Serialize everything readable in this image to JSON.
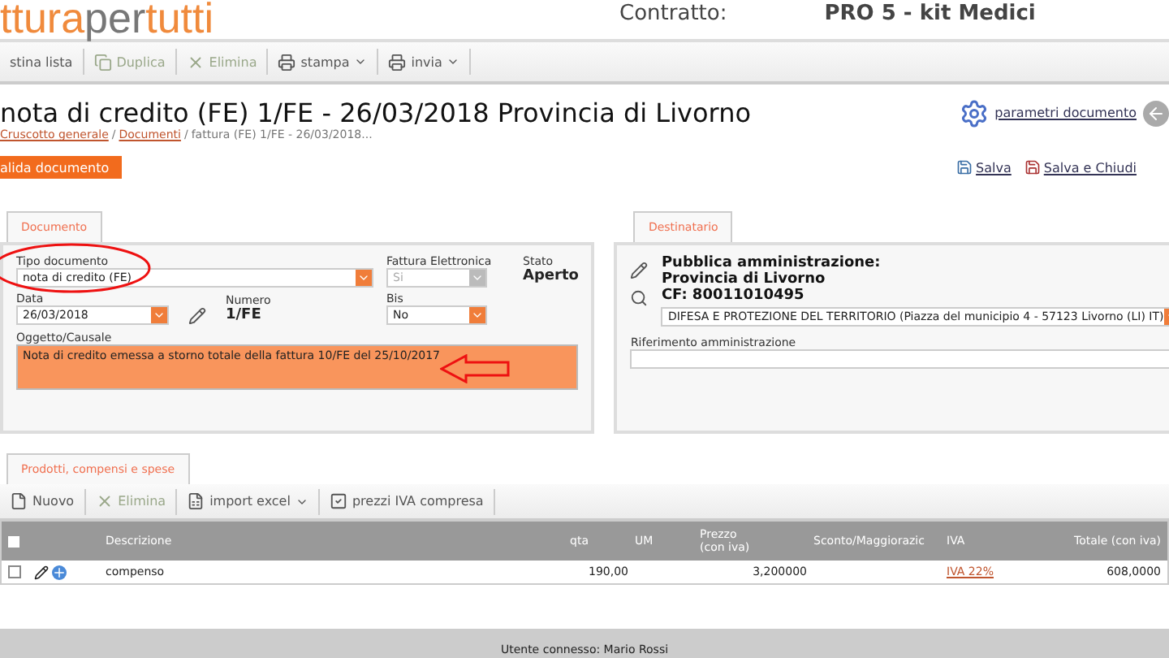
{
  "header": {
    "logo_parts": [
      "ttura",
      "per",
      "tutti"
    ],
    "contract_label": "Contratto:",
    "contract_value": "PRO 5 - kit Medici"
  },
  "toolbar": [
    {
      "label": "stina lista",
      "disabled": false,
      "caret": false
    },
    {
      "label": "Duplica",
      "disabled": true,
      "caret": false
    },
    {
      "label": "Elimina",
      "disabled": true,
      "caret": false
    },
    {
      "label": "stampa",
      "disabled": false,
      "caret": true
    },
    {
      "label": "invia",
      "disabled": false,
      "caret": true
    }
  ],
  "title": "nota di credito (FE) 1/FE - 26/03/2018 Provincia di Livorno",
  "breadcrumb": [
    {
      "label": "Cruscotto generale",
      "link": true
    },
    {
      "label": "/",
      "link": false
    },
    {
      "label": "Documenti",
      "link": true
    },
    {
      "label": "/",
      "link": false
    },
    {
      "label": "fattura (FE) 1/FE - 26/03/2018...",
      "link": false
    }
  ],
  "settings_link": "parametri documento",
  "validate_button": "alida documento",
  "actions": [
    {
      "label": "Salva"
    },
    {
      "label": "Salva e Chiudi"
    }
  ],
  "documento": {
    "tab": "Documento",
    "tipo": {
      "label": "Tipo documento",
      "value": "nota di credito (FE)"
    },
    "fattura_elettronica": {
      "label": "Fattura Elettronica",
      "value": "Si",
      "disabled": true
    },
    "stato": {
      "label": "Stato",
      "value": "Aperto"
    },
    "data": {
      "label": "Data",
      "value": "26/03/2018"
    },
    "numero": {
      "label": "Numero",
      "value": "1/FE"
    },
    "bis": {
      "label": "Bis",
      "value": "No"
    },
    "oggetto": {
      "label": "Oggetto/Causale",
      "value": "Nota di credito emessa a storno totale della fattura 10/FE del 25/10/2017"
    }
  },
  "destinatario": {
    "tab": "Destinatario",
    "lines": [
      "Pubblica amministrazione:",
      "Provincia di Livorno",
      "CF: 80011010495"
    ],
    "ufficio": "DIFESA E PROTEZIONE DEL TERRITORIO (Piazza del municipio 4 - 57123 Livorno (LI) IT)",
    "riferimento": {
      "label": "Riferimento amministrazione"
    }
  },
  "prodotti": {
    "tab": "Prodotti, compensi e spese",
    "toolbar": [
      {
        "label": "Nuovo",
        "disabled": false,
        "caret": false
      },
      {
        "label": "Elimina",
        "disabled": true,
        "caret": false
      },
      {
        "label": "import excel",
        "disabled": false,
        "caret": true
      },
      {
        "label": "prezzi IVA compresa",
        "disabled": false,
        "caret": false
      }
    ],
    "header_checked": false,
    "columns": [
      "Descrizione",
      "qta",
      "UM",
      "Prezzo\n(con iva)",
      "Sconto/Maggiorazic",
      "IVA",
      "Totale (con iva)"
    ],
    "rows": [
      {
        "checked": false,
        "cells": [
          "compenso",
          "190,00",
          "",
          "3,200000",
          "",
          "IVA 22%",
          "608,0000"
        ]
      }
    ]
  },
  "footer": {
    "user": "Utente connesso: Mario Rossi"
  }
}
